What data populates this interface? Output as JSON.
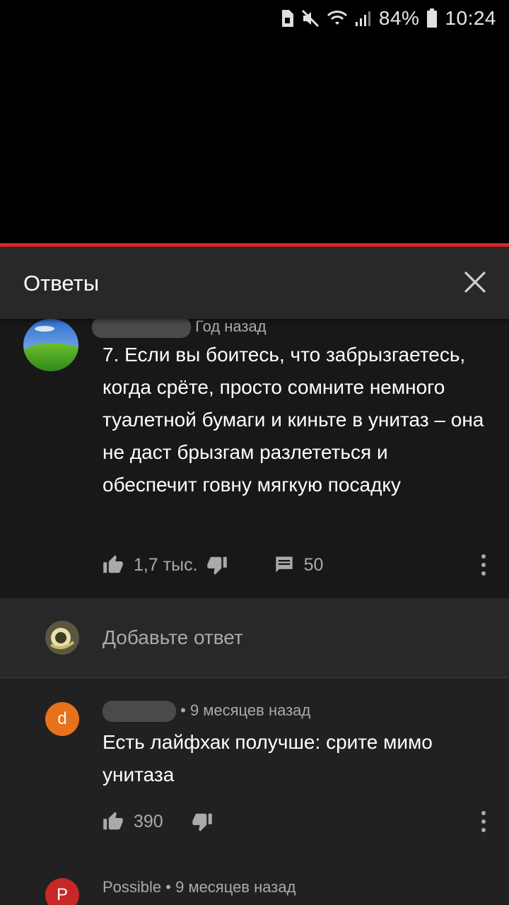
{
  "status_bar": {
    "battery": "84%",
    "time": "10:24",
    "icons": [
      "sim-icon",
      "mute-icon",
      "wifi-icon",
      "signal-icon",
      "battery-icon"
    ]
  },
  "panel": {
    "title": "Ответы",
    "close_icon": "close-icon"
  },
  "main_comment": {
    "time": "Год назад",
    "text": "7. Если вы боитесь, что забрызгаетесь, когда срёте, просто сомните немного туалетной бумаги и киньте в унитаз – она не даст брызгам разлететься и обеспечит говну мягкую посадку",
    "likes": "1,7 тыс.",
    "replies": "50"
  },
  "add_reply": {
    "placeholder": "Добавьте ответ"
  },
  "replies": [
    {
      "avatar_letter": "d",
      "avatar_color": "#e8711c",
      "meta": "• 9 месяцев назад",
      "text": "Есть лайфхак получше: срите мимо унитаза",
      "likes": "390"
    },
    {
      "avatar_letter": "P",
      "avatar_color": "#d32f2f",
      "author": "Possible",
      "meta": "• 9 месяцев назад"
    }
  ],
  "colors": {
    "accent_red": "#e52525",
    "background": "#212121",
    "secondary_text": "#aaaaaa"
  }
}
